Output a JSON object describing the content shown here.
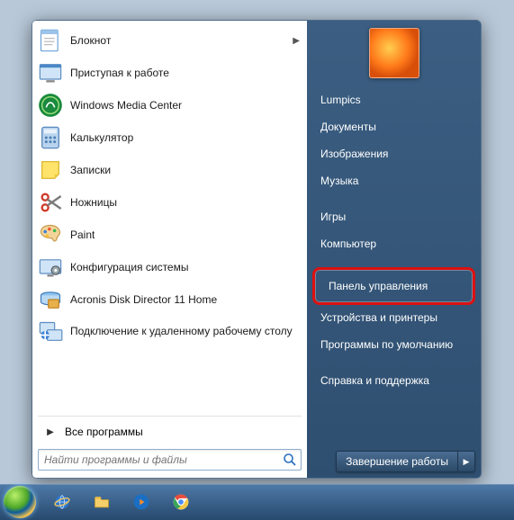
{
  "left": {
    "programs": [
      {
        "label": "Блокнот",
        "icon": "notepad",
        "has_submenu": true
      },
      {
        "label": "Приступая к работе",
        "icon": "getting-started"
      },
      {
        "label": "Windows Media Center",
        "icon": "wmc"
      },
      {
        "label": "Калькулятор",
        "icon": "calculator"
      },
      {
        "label": "Записки",
        "icon": "sticky-notes"
      },
      {
        "label": "Ножницы",
        "icon": "snipping"
      },
      {
        "label": "Paint",
        "icon": "paint"
      },
      {
        "label": "Конфигурация системы",
        "icon": "msconfig"
      },
      {
        "label": "Acronis Disk Director 11 Home",
        "icon": "acronis"
      },
      {
        "label": "Подключение к удаленному рабочему столу",
        "icon": "rdp"
      }
    ],
    "all_programs": "Все программы",
    "search_placeholder": "Найти программы и файлы"
  },
  "right": {
    "items": [
      {
        "label": "Lumpics"
      },
      {
        "label": "Документы"
      },
      {
        "label": "Изображения"
      },
      {
        "label": "Музыка"
      },
      {
        "label": "Игры"
      },
      {
        "label": "Компьютер"
      },
      {
        "label": "Панель управления",
        "highlight": true
      },
      {
        "label": "Устройства и принтеры"
      },
      {
        "label": "Программы по умолчанию"
      },
      {
        "label": "Справка и поддержка"
      }
    ],
    "shutdown": "Завершение работы"
  },
  "taskbar": {
    "icons": [
      "ie",
      "folder",
      "wmp",
      "chrome"
    ]
  }
}
